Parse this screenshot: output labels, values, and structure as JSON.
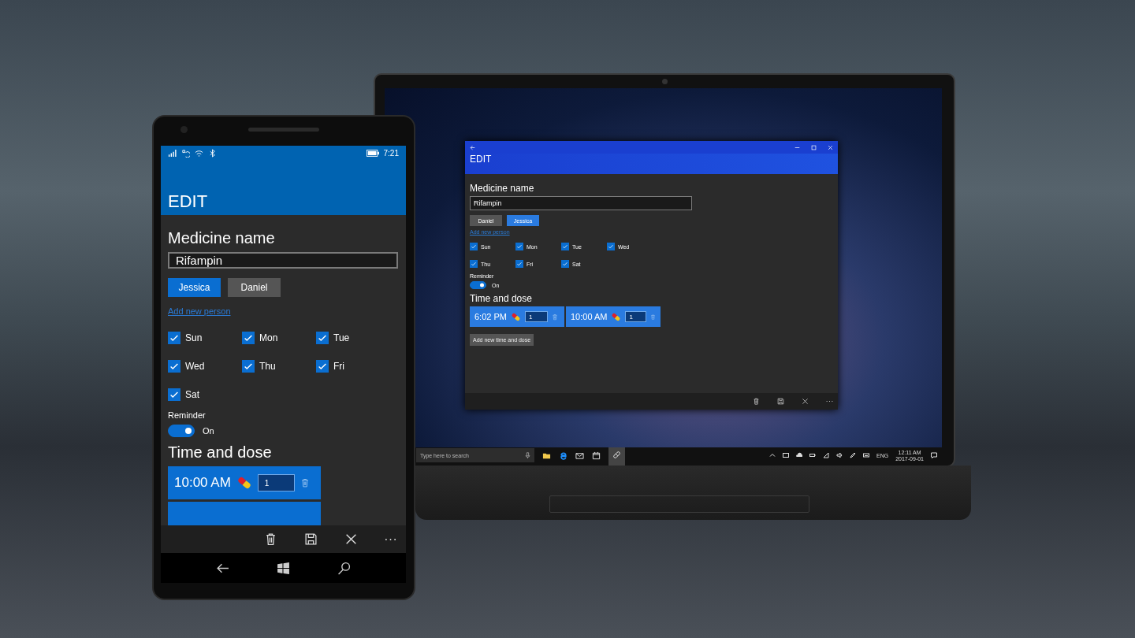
{
  "phone": {
    "status_bar": {
      "time": "7:21"
    },
    "form": {
      "title": "EDIT",
      "medicine_label": "Medicine name",
      "medicine_value": "Rifampin",
      "people": [
        {
          "label": "Jessica",
          "selected": true
        },
        {
          "label": "Daniel",
          "selected": false
        }
      ],
      "add_person_link": "Add new person",
      "days": [
        {
          "label": "Sun",
          "checked": true
        },
        {
          "label": "Mon",
          "checked": true
        },
        {
          "label": "Tue",
          "checked": true
        },
        {
          "label": "Wed",
          "checked": true
        },
        {
          "label": "Thu",
          "checked": true
        },
        {
          "label": "Fri",
          "checked": true
        },
        {
          "label": "Sat",
          "checked": true
        }
      ],
      "reminder": {
        "label": "Reminder",
        "on": true,
        "state_text": "On"
      },
      "time_dose_heading": "Time and dose",
      "doses": [
        {
          "time": "10:00 AM",
          "dose": "1"
        }
      ]
    }
  },
  "laptop": {
    "form": {
      "title": "EDIT",
      "medicine_label": "Medicine name",
      "medicine_value": "Rifampin",
      "people": [
        {
          "label": "Daniel",
          "selected": false
        },
        {
          "label": "Jessica",
          "selected": true
        }
      ],
      "add_person_link": "Add new person",
      "days": [
        {
          "label": "Sun",
          "checked": true
        },
        {
          "label": "Mon",
          "checked": true
        },
        {
          "label": "Tue",
          "checked": true
        },
        {
          "label": "Wed",
          "checked": true
        },
        {
          "label": "Thu",
          "checked": true
        },
        {
          "label": "Fri",
          "checked": true
        },
        {
          "label": "Sat",
          "checked": true
        }
      ],
      "reminder": {
        "label": "Reminder",
        "on": true,
        "state_text": "On"
      },
      "time_dose_heading": "Time and dose",
      "doses": [
        {
          "time": "6:02 PM",
          "dose": "1"
        },
        {
          "time": "10:00 AM",
          "dose": "1"
        }
      ],
      "add_dose_button": "Add new time and dose"
    },
    "taskbar": {
      "search_placeholder": "Type here to search",
      "language": "ENG",
      "time": "12:11 AM",
      "date": "2017-09-01"
    }
  }
}
